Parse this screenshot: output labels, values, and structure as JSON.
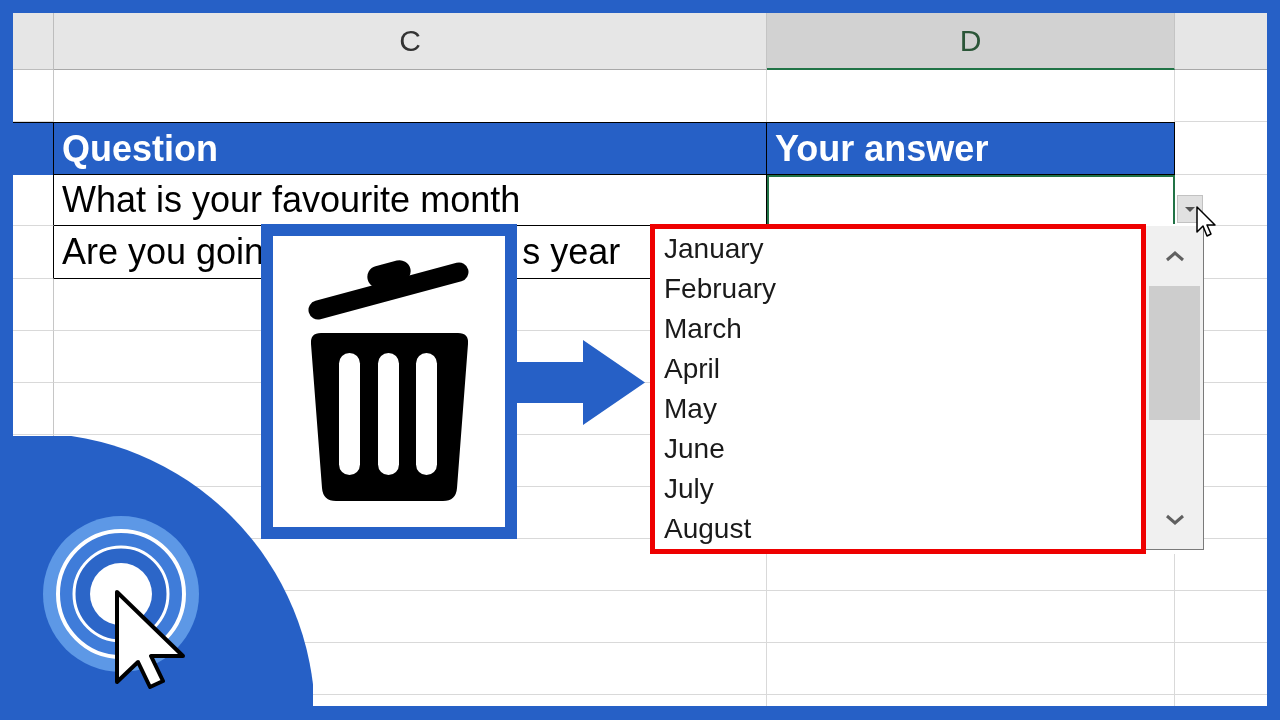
{
  "column_headers": [
    {
      "label": "C",
      "selected": false
    },
    {
      "label": "D",
      "selected": true
    }
  ],
  "table": {
    "header": [
      "Question",
      "Your answer"
    ],
    "rows": [
      {
        "question_parts": [
          "What is your favourite month"
        ],
        "answer_selected": true
      },
      {
        "question_parts": [
          "Are you goin",
          "s year"
        ]
      }
    ]
  },
  "dropdown": {
    "options": [
      "January",
      "February",
      "March",
      "April",
      "May",
      "June",
      "July",
      "August"
    ]
  }
}
